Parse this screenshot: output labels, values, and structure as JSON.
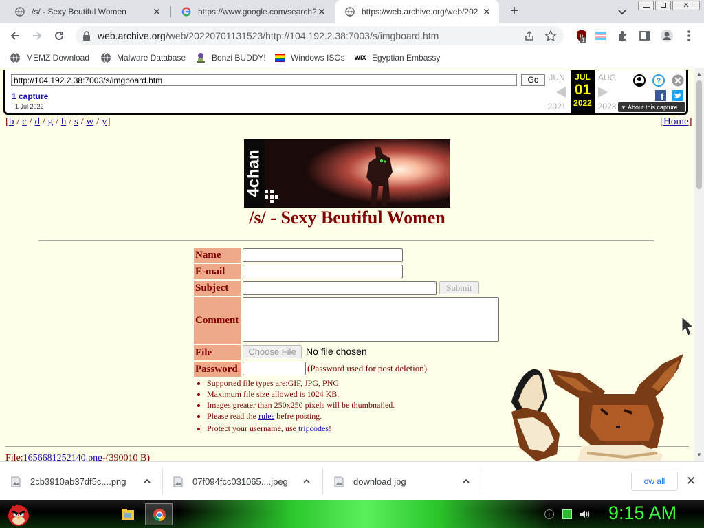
{
  "tabs": [
    {
      "title": "/s/ - Sexy Beutiful Women",
      "active": false
    },
    {
      "title": "https://www.google.com/search?",
      "active": false
    },
    {
      "title": "https://web.archive.org/web/202",
      "active": true
    }
  ],
  "toolbar": {
    "url_host": "web.archive.org",
    "url_path": "/web/20220701131523/http://104.192.2.38:7003/s/imgboard.htm",
    "extension_badge": "1"
  },
  "bookmarks": [
    {
      "label": "MEMZ Download",
      "icon": "globe-icon"
    },
    {
      "label": "Malware Database",
      "icon": "globe-icon"
    },
    {
      "label": "Bonzi BUDDY!",
      "icon": "bonzi-icon"
    },
    {
      "label": "Windows ISOs",
      "icon": "windows-flag-icon"
    },
    {
      "label": "Egyptian Embassy",
      "icon": "wix-icon"
    }
  ],
  "wayback": {
    "url_value": "http://104.192.2.38:7003/s/imgboard.htm",
    "go_label": "Go",
    "captures_link": "1 capture",
    "capture_date": "1 Jul 2022",
    "prev_month": "JUN",
    "cur_month": "JUL",
    "next_month": "AUG",
    "cur_day": "01",
    "prev_year": "2021",
    "cur_year": "2022",
    "next_year": "2023",
    "about_label": "About this capture"
  },
  "board": {
    "nav_links": [
      "b",
      "c",
      "d",
      "g",
      "h",
      "s",
      "w",
      "y"
    ],
    "home_label": "Home",
    "banner_text": "4chan",
    "title": "/s/ - Sexy Beutiful Women",
    "form": {
      "name_label": "Name",
      "email_label": "E-mail",
      "subject_label": "Subject",
      "comment_label": "Comment",
      "file_label": "File",
      "password_label": "Password",
      "submit_label": "Submit",
      "choose_file_label": "Choose File",
      "no_file_text": "No file chosen",
      "password_note": "(Password used for post deletion)"
    },
    "rules": {
      "r1": "Supported file types are:GIF, JPG, PNG",
      "r2": "Maximum file size allowed is 1024 KB.",
      "r3": "Images greater than 250x250 pixels will be thumbnailed.",
      "r4_pre": "Please read the ",
      "r4_link": "rules",
      "r4_post": " befre posting.",
      "r5_pre": " Protect your username, use ",
      "r5_link": "tripcodes",
      "r5_post": "!"
    },
    "file_prefix": "File:",
    "file_link": "1656681252140.png",
    "file_size": "-(390010 B)"
  },
  "downloads": [
    {
      "name": "2cb3910ab37df5c....png"
    },
    {
      "name": "07f094fcc031065....jpeg"
    },
    {
      "name": "download.jpg"
    }
  ],
  "downloads_show_all": "ow all",
  "taskbar": {
    "clock": "9:15 AM"
  },
  "colors": {
    "page_bg": "#ffffe9",
    "board_maroon": "#800000",
    "form_label_bg": "#ea8",
    "clock_green": "#3dff3d"
  }
}
